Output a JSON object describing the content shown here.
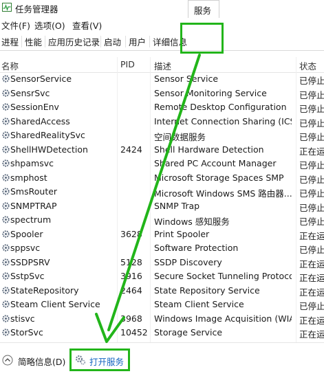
{
  "window": {
    "title": "任务管理器"
  },
  "menu": [
    "文件(F)",
    "选项(O)",
    "查看(V)"
  ],
  "tabs": [
    "进程",
    "性能",
    "应用历史记录",
    "启动",
    "用户",
    "详细信息",
    "服务"
  ],
  "selected_tab": "服务",
  "columns": {
    "name": "名称",
    "pid": "PID",
    "desc": "描述",
    "status": "状态"
  },
  "services": [
    {
      "name": "SensorService",
      "pid": "",
      "desc": "Sensor Service",
      "status": "已停止"
    },
    {
      "name": "SensrSvc",
      "pid": "",
      "desc": "Sensor Monitoring Service",
      "status": "已停止"
    },
    {
      "name": "SessionEnv",
      "pid": "",
      "desc": "Remote Desktop Configuration",
      "status": "已停止"
    },
    {
      "name": "SharedAccess",
      "pid": "",
      "desc": "Internet Connection Sharing (ICS)",
      "status": "已停止"
    },
    {
      "name": "SharedRealitySvc",
      "pid": "",
      "desc": "空间数据服务",
      "status": "已停止"
    },
    {
      "name": "ShellHWDetection",
      "pid": "2424",
      "desc": "Shell Hardware Detection",
      "status": "正在运行"
    },
    {
      "name": "shpamsvc",
      "pid": "",
      "desc": "Shared PC Account Manager",
      "status": "已停止"
    },
    {
      "name": "smphost",
      "pid": "",
      "desc": "Microsoft Storage Spaces SMP",
      "status": "已停止"
    },
    {
      "name": "SmsRouter",
      "pid": "",
      "desc": "Microsoft Windows SMS 路由器...",
      "status": "已停止"
    },
    {
      "name": "SNMPTRAP",
      "pid": "",
      "desc": "SNMP Trap",
      "status": "已停止"
    },
    {
      "name": "spectrum",
      "pid": "",
      "desc": "Windows 感知服务",
      "status": "已停止"
    },
    {
      "name": "Spooler",
      "pid": "3628",
      "desc": "Print Spooler",
      "status": "正在运行"
    },
    {
      "name": "sppsvc",
      "pid": "",
      "desc": "Software Protection",
      "status": "已停止"
    },
    {
      "name": "SSDPSRV",
      "pid": "5128",
      "desc": "SSDP Discovery",
      "status": "正在运行"
    },
    {
      "name": "SstpSvc",
      "pid": "3916",
      "desc": "Secure Socket Tunneling Protoco...",
      "status": "正在运行"
    },
    {
      "name": "StateRepository",
      "pid": "2464",
      "desc": "State Repository Service",
      "status": "正在运行"
    },
    {
      "name": "Steam Client Service",
      "pid": "",
      "desc": "Steam Client Service",
      "status": "已停止"
    },
    {
      "name": "stisvc",
      "pid": "3968",
      "desc": "Windows Image Acquisition (WIA)",
      "status": "正在运行"
    },
    {
      "name": "StorSvc",
      "pid": "10452",
      "desc": "Storage Service",
      "status": "正在运行"
    }
  ],
  "footer": {
    "brief": "简略信息(D)",
    "open_services": "打开服务"
  },
  "colors": {
    "highlight": "#22b51a",
    "link": "#1565c0"
  },
  "icons": [
    "task-manager-icon",
    "gear-icon",
    "chevron-up-icon",
    "services-icon"
  ]
}
